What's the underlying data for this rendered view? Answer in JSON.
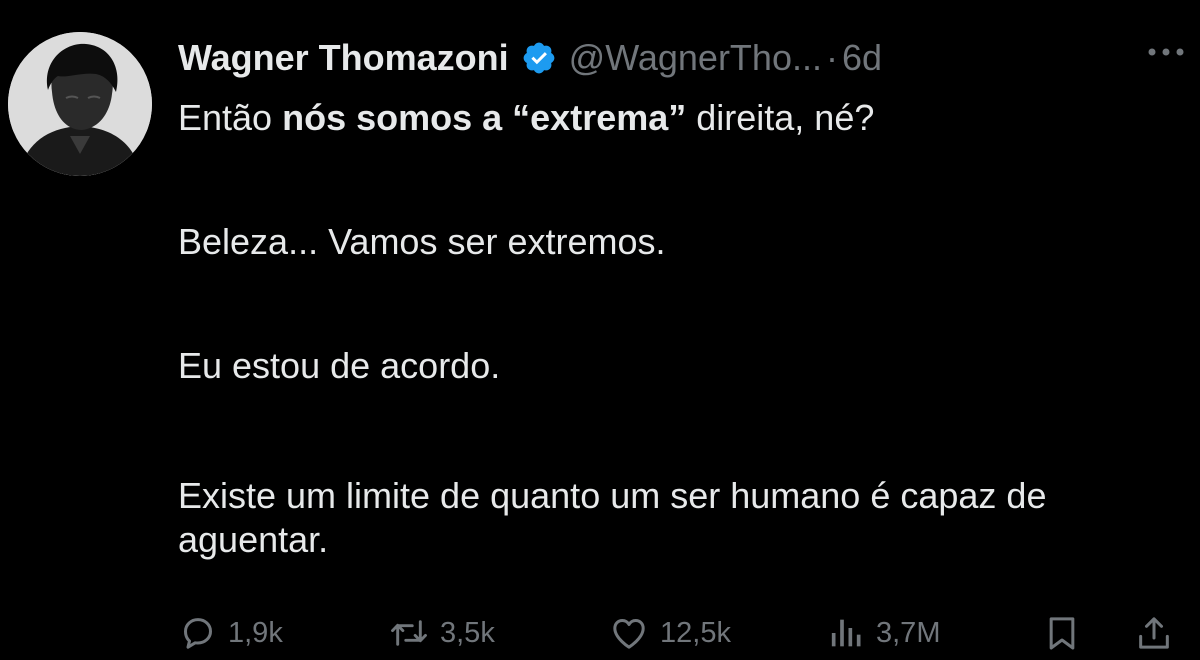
{
  "tweet": {
    "author": {
      "display_name": "Wagner Thomazoni",
      "handle": "@WagnerTho...",
      "verified": true,
      "verified_color": "#1d9bf0"
    },
    "separator": "·",
    "timestamp": "6d",
    "body": {
      "line1_pre": "Então ",
      "line1_bold": "nós somos a “extrema”",
      "line1_post": " direita, né?",
      "line2": "Beleza... Vamos ser extremos.",
      "line3": "Eu estou de acordo.",
      "line4": "Existe um limite de quanto um ser humano é capaz de aguentar."
    },
    "actions": {
      "replies": "1,9k",
      "retweets": "3,5k",
      "likes": "12,5k",
      "views": "3,7M"
    }
  },
  "theme": {
    "background": "#000000",
    "text": "#e7e9ea",
    "muted": "#71767b"
  },
  "icons": {
    "verified": "verified-badge-icon",
    "more": "more-options-icon",
    "reply": "reply-icon",
    "retweet": "retweet-icon",
    "like": "heart-icon",
    "views": "views-chart-icon",
    "bookmark": "bookmark-icon",
    "share": "share-icon"
  }
}
